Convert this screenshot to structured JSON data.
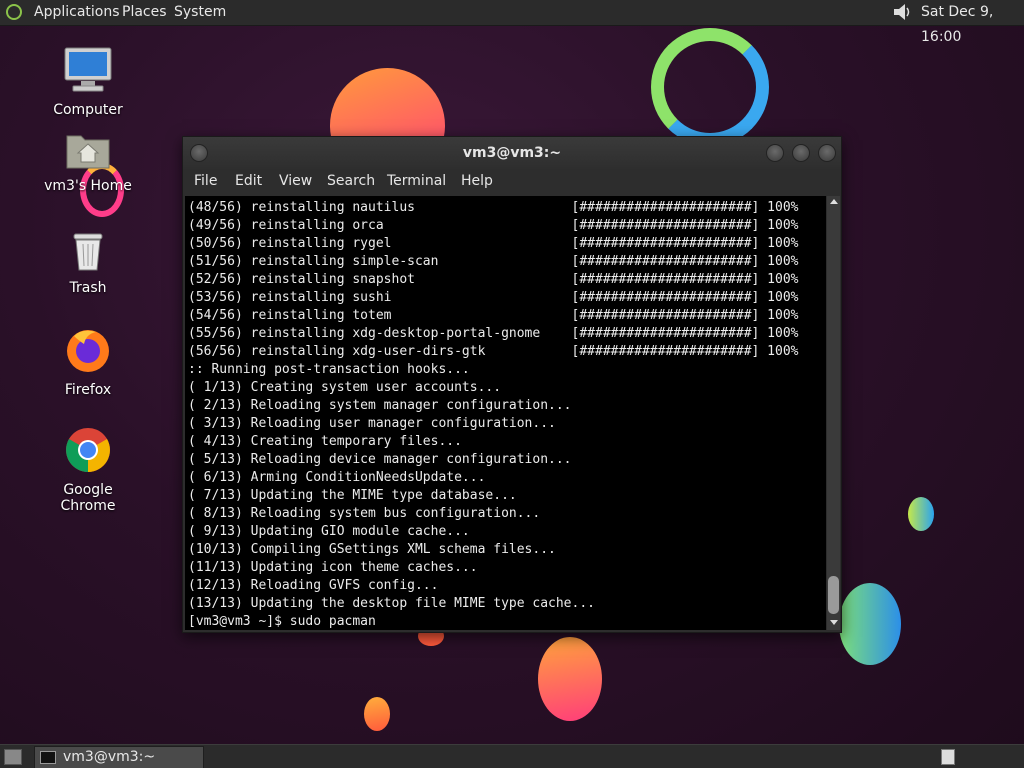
{
  "top_panel": {
    "menus": [
      "Applications",
      "Places",
      "System"
    ],
    "clock": "Sat Dec  9, 16:00"
  },
  "desktop": {
    "icons": [
      {
        "label": "Computer",
        "icon": "computer-icon"
      },
      {
        "label": "vm3's Home",
        "icon": "home-folder-icon"
      },
      {
        "label": "Trash",
        "icon": "trash-icon"
      },
      {
        "label": "Firefox",
        "icon": "firefox-icon"
      },
      {
        "label": "Google Chrome",
        "icon": "chrome-icon"
      }
    ]
  },
  "terminal": {
    "title": "vm3@vm3:~",
    "menu": [
      "File",
      "Edit",
      "View",
      "Search",
      "Terminal",
      "Help"
    ],
    "lines": [
      "(48/56) reinstalling nautilus                    [######################] 100%",
      "(49/56) reinstalling orca                        [######################] 100%",
      "(50/56) reinstalling rygel                       [######################] 100%",
      "(51/56) reinstalling simple-scan                 [######################] 100%",
      "(52/56) reinstalling snapshot                    [######################] 100%",
      "(53/56) reinstalling sushi                       [######################] 100%",
      "(54/56) reinstalling totem                       [######################] 100%",
      "(55/56) reinstalling xdg-desktop-portal-gnome    [######################] 100%",
      "(56/56) reinstalling xdg-user-dirs-gtk           [######################] 100%",
      ":: Running post-transaction hooks...",
      "( 1/13) Creating system user accounts...",
      "( 2/13) Reloading system manager configuration...",
      "( 3/13) Reloading user manager configuration...",
      "( 4/13) Creating temporary files...",
      "( 5/13) Reloading device manager configuration...",
      "( 6/13) Arming ConditionNeedsUpdate...",
      "( 7/13) Updating the MIME type database...",
      "( 8/13) Reloading system bus configuration...",
      "( 9/13) Updating GIO module cache...",
      "(10/13) Compiling GSettings XML schema files...",
      "(11/13) Updating icon theme caches...",
      "(12/13) Reloading GVFS config...",
      "(13/13) Updating the desktop file MIME type cache...",
      "[vm3@vm3 ~]$ sudo pacman"
    ]
  },
  "taskbar": {
    "task_label": "vm3@vm3:~"
  }
}
